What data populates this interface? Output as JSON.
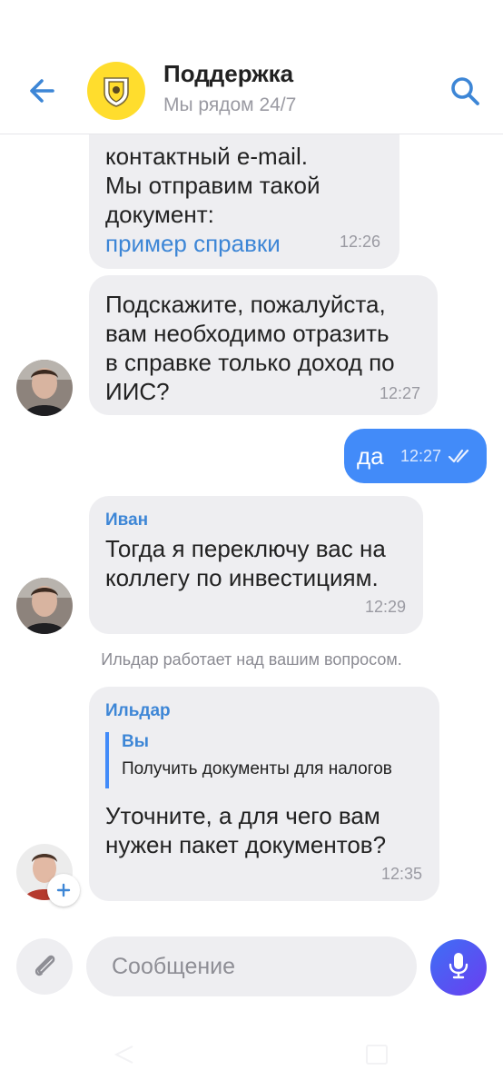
{
  "header": {
    "title": "Поддержка",
    "subtitle": "Мы рядом 24/7"
  },
  "messages": [
    {
      "lines": [
        "контактный e-mail.",
        "Мы отправим такой",
        "документ:"
      ],
      "link": "пример справки",
      "time": "12:26"
    },
    {
      "lines": [
        "Подскажите, пожалуйста,",
        "вам необходимо отразить",
        "в справке только доход по",
        "ИИС?"
      ],
      "time": "12:27"
    },
    {
      "text": "да",
      "time": "12:27",
      "status": "read"
    },
    {
      "sender": "Иван",
      "lines": [
        "Тогда я переключу вас на",
        "коллегу по инвестициям."
      ],
      "time": "12:29"
    },
    {
      "system": "Ильдар работает над вашим вопросом."
    },
    {
      "sender": "Ильдар",
      "quote": {
        "author": "Вы",
        "text": "Получить документы для налогов"
      },
      "lines": [
        "Уточните, а для чего вам",
        "нужен пакет документов?"
      ],
      "time": "12:35"
    }
  ],
  "input": {
    "placeholder": "Сообщение"
  },
  "colors": {
    "accent": "#3d86d6",
    "outgoing": "#428bf9",
    "incoming": "#eeeef1",
    "logo": "#ffdd2d"
  },
  "icons": [
    "back-arrow-icon",
    "bank-logo-icon",
    "search-icon",
    "read-checkmarks-icon",
    "paperclip-icon",
    "microphone-icon",
    "add-icon"
  ]
}
